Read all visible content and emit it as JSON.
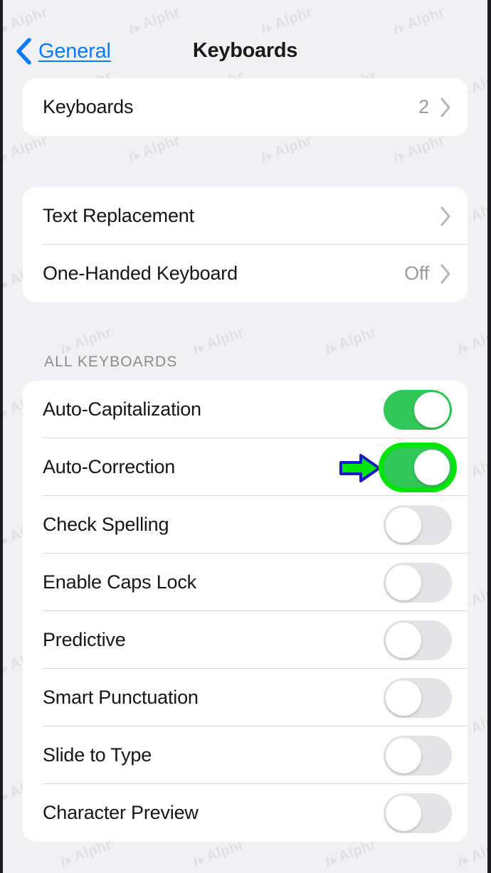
{
  "navbar": {
    "back_label": "General",
    "back_icon": "chevron-left-icon",
    "title": "Keyboards"
  },
  "watermark": {
    "text": "Alphr"
  },
  "sections": [
    {
      "id": "keyboards-card",
      "header": "",
      "rows": [
        {
          "name": "keyboards",
          "label": "Keyboards",
          "value": "2",
          "type": "disclosure",
          "accessory": "chevron-right-icon"
        }
      ]
    },
    {
      "id": "text-card",
      "header": "",
      "rows": [
        {
          "name": "text-replacement",
          "label": "Text Replacement",
          "value": "",
          "type": "disclosure",
          "accessory": "chevron-right-icon"
        },
        {
          "name": "one-handed-keyboard",
          "label": "One-Handed Keyboard",
          "value": "Off",
          "type": "disclosure",
          "accessory": "chevron-right-icon"
        }
      ]
    },
    {
      "id": "all-keyboards-card",
      "header": "ALL KEYBOARDS",
      "rows": [
        {
          "name": "auto-capitalization",
          "label": "Auto-Capitalization",
          "type": "toggle",
          "state": "on",
          "highlighted": false
        },
        {
          "name": "auto-correction",
          "label": "Auto-Correction",
          "type": "toggle",
          "state": "on",
          "highlighted": true
        },
        {
          "name": "check-spelling",
          "label": "Check Spelling",
          "type": "toggle",
          "state": "off",
          "highlighted": false
        },
        {
          "name": "enable-caps-lock",
          "label": "Enable Caps Lock",
          "type": "toggle",
          "state": "off",
          "highlighted": false
        },
        {
          "name": "predictive",
          "label": "Predictive",
          "type": "toggle",
          "state": "off",
          "highlighted": false
        },
        {
          "name": "smart-punctuation",
          "label": "Smart Punctuation",
          "type": "toggle",
          "state": "off",
          "highlighted": false
        },
        {
          "name": "slide-to-type",
          "label": "Slide to Type",
          "type": "toggle",
          "state": "off",
          "highlighted": false
        },
        {
          "name": "character-preview",
          "label": "Character Preview",
          "type": "toggle",
          "state": "off",
          "highlighted": false
        }
      ]
    }
  ],
  "annotation": {
    "arrow_icon": "arrow-right-icon",
    "arrow_fill": "#00E508",
    "arrow_stroke": "#1a1ac8",
    "target_row": "auto-correction"
  },
  "colors": {
    "background": "#f1f1f5",
    "card": "#ffffff",
    "accent_blue": "#0a7aff",
    "toggle_on": "#32c759",
    "toggle_off": "#e4e4e7",
    "highlight_ring": "#00e508",
    "secondary_text": "#9a9aa1"
  }
}
